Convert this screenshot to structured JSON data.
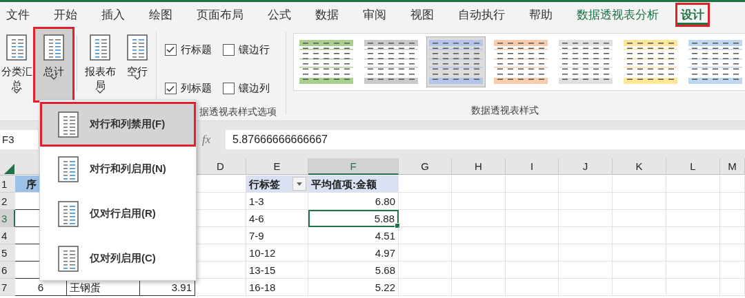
{
  "tabs": [
    {
      "label": "文件",
      "kind": "normal",
      "selected": false,
      "annotated": false
    },
    {
      "label": "开始",
      "kind": "normal",
      "selected": false,
      "annotated": false
    },
    {
      "label": "插入",
      "kind": "normal",
      "selected": false,
      "annotated": false
    },
    {
      "label": "绘图",
      "kind": "normal",
      "selected": false,
      "annotated": false
    },
    {
      "label": "页面布局",
      "kind": "normal",
      "selected": false,
      "annotated": false
    },
    {
      "label": "公式",
      "kind": "normal",
      "selected": false,
      "annotated": false
    },
    {
      "label": "数据",
      "kind": "normal",
      "selected": false,
      "annotated": false
    },
    {
      "label": "审阅",
      "kind": "normal",
      "selected": false,
      "annotated": false
    },
    {
      "label": "视图",
      "kind": "normal",
      "selected": false,
      "annotated": false
    },
    {
      "label": "自动执行",
      "kind": "normal",
      "selected": false,
      "annotated": false
    },
    {
      "label": "帮助",
      "kind": "normal",
      "selected": false,
      "annotated": false
    },
    {
      "label": "数据透视表分析",
      "kind": "contextual",
      "selected": false,
      "annotated": false
    },
    {
      "label": "设计",
      "kind": "contextual",
      "selected": true,
      "annotated": true
    }
  ],
  "ribbon": {
    "buttons": [
      {
        "label": "分类汇总",
        "pressed": false,
        "annotated": false
      },
      {
        "label": "总计",
        "pressed": true,
        "annotated": true
      },
      {
        "label": "报表布局",
        "pressed": false,
        "annotated": false
      },
      {
        "label": "空行",
        "pressed": false,
        "annotated": false
      }
    ],
    "checkboxes": [
      {
        "label": "行标题",
        "checked": true
      },
      {
        "label": "镶边行",
        "checked": false
      },
      {
        "label": "列标题",
        "checked": true
      },
      {
        "label": "镶边列",
        "checked": false
      }
    ],
    "options_group_label": "据透视表样式选项",
    "styles": [
      {
        "color": "#a9d08e",
        "selected": false
      },
      {
        "color": "#c9c9c9",
        "selected": false
      },
      {
        "color": "#b4c6e7",
        "selected": true
      },
      {
        "color": "#f8cbad",
        "selected": false
      },
      {
        "color": "#e0e0e0",
        "selected": false
      },
      {
        "color": "#ffe699",
        "selected": false
      },
      {
        "color": "#bdd7ee",
        "selected": false
      }
    ],
    "styles_group_label": "数据透视表样式"
  },
  "menu": {
    "items": [
      {
        "label": "对行和列禁用(F)",
        "kind": "off",
        "selected": true,
        "annotated": true
      },
      {
        "label": "对行和列启用(N)",
        "kind": "both",
        "selected": false,
        "annotated": false
      },
      {
        "label": "仅对行启用(R)",
        "kind": "rows",
        "selected": false,
        "annotated": false
      },
      {
        "label": "仅对列启用(C)",
        "kind": "cols",
        "selected": false,
        "annotated": false
      }
    ]
  },
  "formula_bar": {
    "name_box": "F3",
    "function_label": "fx",
    "value": "5.87666666666667"
  },
  "sheet": {
    "columns": [
      {
        "selected": false
      },
      {},
      {},
      {
        "label": "D",
        "selected": false
      },
      {
        "label": "E",
        "selected": false
      },
      {
        "label": "F",
        "selected": true
      },
      {
        "label": "G",
        "selected": false
      },
      {
        "label": "H",
        "selected": false
      },
      {
        "label": "I",
        "selected": false
      },
      {
        "label": "J",
        "selected": false
      },
      {
        "label": "K",
        "selected": false
      },
      {
        "label": "L",
        "selected": false
      },
      {
        "label": "M",
        "selected": false
      }
    ],
    "rows": [
      {
        "header": "1",
        "selected": false,
        "cells": [
          {
            "kind": "table-header",
            "text": "序"
          },
          {},
          {},
          {
            "selected": false
          },
          {
            "kind": "pivot-header",
            "text": "行标签",
            "filter": true,
            "selected": false
          },
          {
            "kind": "pivot-header",
            "text": "平均值项:金额",
            "selected": false
          },
          {
            "selected": false
          },
          {
            "selected": false
          },
          {
            "selected": false
          },
          {
            "selected": false
          },
          {
            "selected": false
          },
          {
            "selected": false
          },
          {
            "selected": false
          }
        ]
      },
      {
        "header": "2",
        "selected": false,
        "cells": [
          {
            "kind": "table",
            "selected": false
          },
          {},
          {},
          {
            "selected": false
          },
          {
            "kind": "text",
            "text": "1-3",
            "selected": false
          },
          {
            "kind": "number",
            "text": "6.80",
            "selected": false
          },
          {
            "selected": false
          },
          {
            "selected": false
          },
          {
            "selected": false
          },
          {
            "selected": false
          },
          {
            "selected": false
          },
          {
            "selected": false
          },
          {
            "selected": false
          }
        ]
      },
      {
        "header": "3",
        "selected": true,
        "cells": [
          {
            "kind": "table",
            "selected": false
          },
          {},
          {},
          {
            "selected": false
          },
          {
            "kind": "text",
            "text": "4-6",
            "selected": false
          },
          {
            "kind": "number",
            "text": "5.88",
            "selected": true
          },
          {
            "selected": false
          },
          {
            "selected": false
          },
          {
            "selected": false
          },
          {
            "selected": false
          },
          {
            "selected": false
          },
          {
            "selected": false
          },
          {
            "selected": false
          }
        ]
      },
      {
        "header": "4",
        "selected": false,
        "cells": [
          {
            "kind": "table",
            "selected": false
          },
          {},
          {},
          {
            "selected": false
          },
          {
            "kind": "text",
            "text": "7-9",
            "selected": false
          },
          {
            "kind": "number",
            "text": "4.51",
            "selected": false
          },
          {
            "selected": false
          },
          {
            "selected": false
          },
          {
            "selected": false
          },
          {
            "selected": false
          },
          {
            "selected": false
          },
          {
            "selected": false
          },
          {
            "selected": false
          }
        ]
      },
      {
        "header": "5",
        "selected": false,
        "cells": [
          {
            "kind": "table",
            "selected": false
          },
          {},
          {},
          {
            "selected": false
          },
          {
            "kind": "text",
            "text": "10-12",
            "selected": false
          },
          {
            "kind": "number",
            "text": "4.97",
            "selected": false
          },
          {
            "selected": false
          },
          {
            "selected": false
          },
          {
            "selected": false
          },
          {
            "selected": false
          },
          {
            "selected": false
          },
          {
            "selected": false
          },
          {
            "selected": false
          }
        ]
      },
      {
        "header": "6",
        "selected": false,
        "cells": [
          {
            "kind": "table",
            "selected": false
          },
          {},
          {},
          {
            "selected": false
          },
          {
            "kind": "text",
            "text": "13-15",
            "selected": false
          },
          {
            "kind": "number",
            "text": "5.68",
            "selected": false
          },
          {
            "selected": false
          },
          {
            "selected": false
          },
          {
            "selected": false
          },
          {
            "selected": false
          },
          {
            "selected": false
          },
          {
            "selected": false
          },
          {
            "selected": false
          }
        ]
      },
      {
        "header": "7",
        "selected": false,
        "cells": [
          {
            "kind": "table-number",
            "text": "6",
            "selected": false
          },
          {
            "kind": "table-text",
            "text": "王钢蛋",
            "selected": false
          },
          {
            "kind": "table-value",
            "text": "3.91",
            "selected": false
          },
          {
            "selected": false
          },
          {
            "kind": "text",
            "text": "16-18",
            "selected": false
          },
          {
            "kind": "number",
            "text": "5.22",
            "selected": false
          },
          {
            "selected": false
          },
          {
            "selected": false
          },
          {
            "selected": false
          },
          {
            "selected": false
          },
          {
            "selected": false
          },
          {
            "selected": false
          },
          {
            "selected": false
          }
        ]
      }
    ]
  }
}
